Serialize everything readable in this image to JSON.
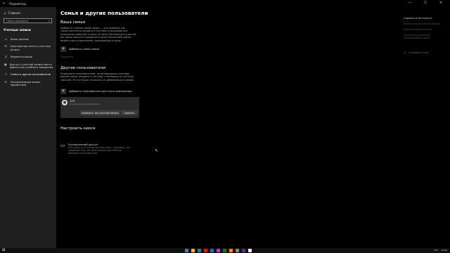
{
  "window": {
    "back_icon": "arrow-left",
    "title": "Параметры",
    "controls": [
      "—",
      "☐",
      "✕"
    ]
  },
  "sidebar": {
    "home_label": "Главная",
    "search_placeholder": "Найти параметр",
    "section_label": "Учетные записи",
    "items": [
      {
        "icon": "person-card-icon",
        "label": "Ваши данные"
      },
      {
        "icon": "mail-icon",
        "label": "Электронная почта и учетные записи"
      },
      {
        "icon": "key-icon",
        "label": "Варианты входа"
      },
      {
        "icon": "briefcase-icon",
        "label": "Доступ к учетной записи места работы или учебного заведения"
      },
      {
        "icon": "people-icon",
        "label": "Семья и другие пользователи"
      },
      {
        "icon": "sync-icon",
        "label": "Синхронизация ваших параметров"
      }
    ]
  },
  "main": {
    "page_title": "Семья и другие пользователи",
    "family": {
      "heading": "Ваша семья",
      "description": "Добавьте членов своей семьи — это позволит им самостоятельно входить в систему и пользоваться отдельным рабочим столом. В целях безопасности детей вы также можете определить допустимые веб-сайты, возрастные ограничения, приложения и игры.",
      "add_label": "Добавить члена семьи",
      "learn_more": "Подробнее"
    },
    "others": {
      "heading": "Другие пользователи",
      "description": "Разрешите пользователям, не являющимся членами вашей семьи, входить в систему с помощью их учетных записей. Это не будет означать их добавления в семью.",
      "add_label": "Добавить пользователя для этого компьютера",
      "account": {
        "name": "123",
        "type": "Локальная учетная запись",
        "change_type_button": "Изменить тип учетной записи",
        "remove_button": "Удалить"
      }
    },
    "kiosk": {
      "heading": "Настроить киоск",
      "title": "Ограниченный доступ",
      "description": "Настройте это устройство как киоск, например, как цифровой знак, интерактивный дисплей или общедоступный браузер."
    }
  },
  "right_panel": {
    "heading": "Справка в Интернете",
    "links": [
      "Переключение учетной записи",
      "Родительский контроль",
      "Ограничение времени использования экрана"
    ],
    "feedback": "Отправить отзыв"
  },
  "taskbar": {
    "apps": [
      "#3a7bd5",
      "#ffb900",
      "#2d7d9a",
      "#e81123",
      "#0078d7",
      "#c239b3",
      "#107c10",
      "#ff8c00",
      "#888888",
      "#5c2d91",
      "#ffffff"
    ],
    "tray_text": "РУС",
    "time": "10:06"
  }
}
